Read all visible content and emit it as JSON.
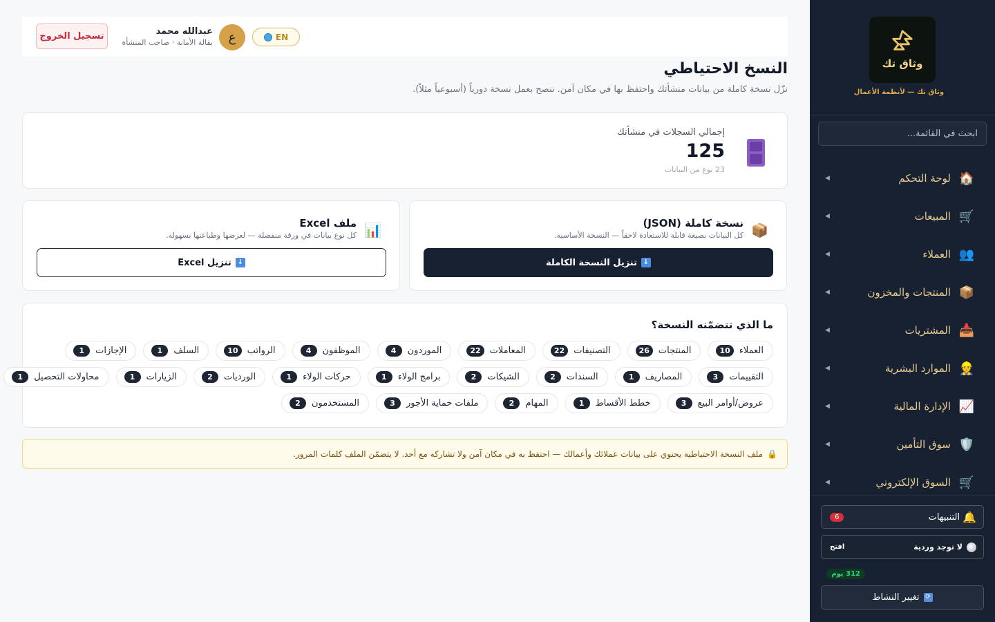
{
  "brand": {
    "logo_text": "وثاق تك",
    "tagline": "وثاق تك — لأنظمة الأعمال"
  },
  "sidebar": {
    "search_placeholder": "ابحث في القائمة...",
    "items": [
      {
        "label": "لوحة التحكم",
        "icon": "home-icon"
      },
      {
        "label": "المبيعات",
        "icon": "cart-icon"
      },
      {
        "label": "العملاء",
        "icon": "users-icon"
      },
      {
        "label": "المنتجات والمخزون",
        "icon": "box-icon"
      },
      {
        "label": "المشتريات",
        "icon": "inbox-icon"
      },
      {
        "label": "الموارد البشرية",
        "icon": "person-icon"
      },
      {
        "label": "الإدارة المالية",
        "icon": "chart-icon"
      },
      {
        "label": "سوق التأمين",
        "icon": "shield-icon"
      },
      {
        "label": "السوق الإلكتروني",
        "icon": "cart-icon"
      }
    ],
    "notifications": {
      "label": "التنبيهات",
      "count": "6"
    },
    "shift": {
      "label": "لا توجد وردية",
      "action": "افتح"
    },
    "days_badge": "312 يوم",
    "switch_label": "تغيير النشاط"
  },
  "header": {
    "logout_label": "تسجيل الخروج",
    "user_name": "عبدالله محمد",
    "user_sub": "بقالة الأمانة · صاحب المنشأة",
    "avatar_letter": "ع",
    "lang_label": "EN"
  },
  "page": {
    "title": "النسخ الاحتياطي",
    "subtitle": "نزّل نسخة كاملة من بيانات منشأتك واحتفظ بها في مكان آمن. ننصح بعمل نسخة دورياً (أسبوعياً مثلاً)."
  },
  "stats": {
    "label": "إجمالي السجلات في منشأتك",
    "value": "125",
    "sub": "23 نوع من البيانات"
  },
  "downloads": {
    "json": {
      "title": "نسخة كاملة (JSON)",
      "desc": "كل البيانات بصيغة قابلة للاستعادة لاحقاً — النسخة الأساسية.",
      "button": "تنزيل النسخة الكاملة"
    },
    "excel": {
      "title": "ملف Excel",
      "desc": "كل نوع بيانات في ورقة منفصلة — لعرضها وطباعتها بسهولة.",
      "button": "تنزيل Excel"
    }
  },
  "includes": {
    "title": "ما الذي تتضمّنه النسخة؟",
    "rows": [
      [
        {
          "label": "العملاء",
          "count": "10"
        },
        {
          "label": "المنتجات",
          "count": "26"
        },
        {
          "label": "التصنيفات",
          "count": "22"
        },
        {
          "label": "المعاملات",
          "count": "22"
        },
        {
          "label": "الموردون",
          "count": "4"
        },
        {
          "label": "الموظفون",
          "count": "4"
        },
        {
          "label": "الرواتب",
          "count": "10"
        },
        {
          "label": "السلف",
          "count": "1"
        },
        {
          "label": "الإجازات",
          "count": "1"
        }
      ],
      [
        {
          "label": "التقييمات",
          "count": "3"
        },
        {
          "label": "المصاريف",
          "count": "1"
        },
        {
          "label": "السندات",
          "count": "2"
        },
        {
          "label": "الشيكات",
          "count": "2"
        },
        {
          "label": "برامج الولاء",
          "count": "1"
        },
        {
          "label": "حركات الولاء",
          "count": "1"
        },
        {
          "label": "الورديات",
          "count": "2"
        },
        {
          "label": "الزيارات",
          "count": "1"
        },
        {
          "label": "محاولات التحصيل",
          "count": "1"
        }
      ],
      [
        {
          "label": "عروض/أوامر البيع",
          "count": "3"
        },
        {
          "label": "خطط الأقساط",
          "count": "1"
        },
        {
          "label": "المهام",
          "count": "2"
        },
        {
          "label": "ملفات حماية الأجور",
          "count": "3"
        },
        {
          "label": "المستخدمون",
          "count": "2"
        }
      ]
    ]
  },
  "warning": "ملف النسخة الاحتياطية يحتوي على بيانات عملائك وأعمالك — احتفظ به في مكان آمن ولا تشاركه مع أحد. لا يتضمّن الملف كلمات المرور.",
  "colors": {
    "sidebar_bg": "#182131",
    "accent_gold": "#d9a94a",
    "primary_dark": "#182131",
    "danger": "#c23040",
    "warning_bg": "#fffbea"
  }
}
